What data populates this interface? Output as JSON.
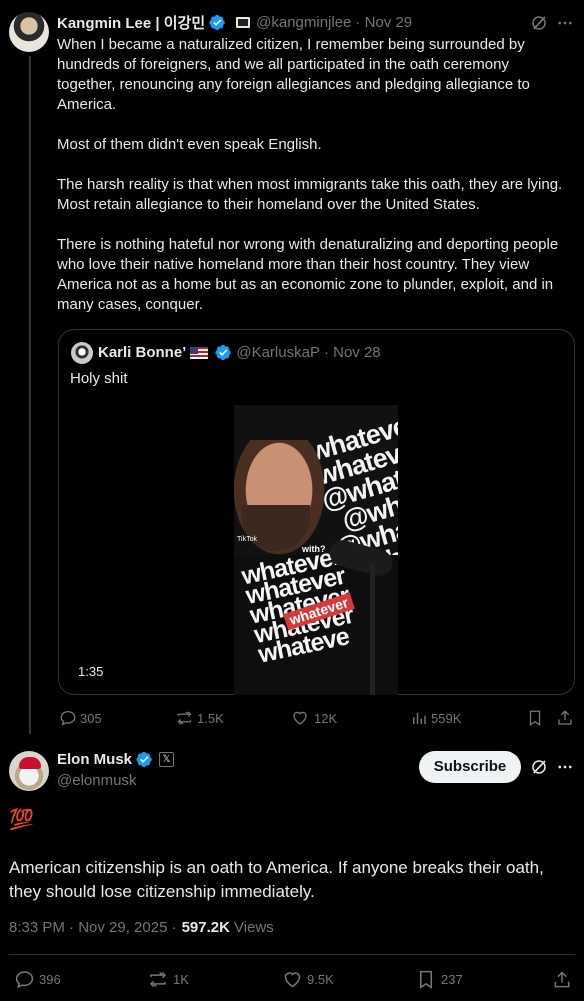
{
  "tweet1": {
    "name": "Kangmin Lee | 이강민",
    "handle": "@kangminjlee",
    "date": "· Nov 29",
    "paragraphs": [
      "When I became a naturalized citizen, I remember being surrounded by hundreds of foreigners, and we all participated in the oath ceremony together, renouncing any foreign allegiances and pledging allegiance to America.",
      "Most of them didn't even speak English.",
      "The harsh reality is that when most immigrants take this oath, they are lying. Most retain allegiance to their homeland over the United States.",
      "There is nothing hateful nor wrong with denaturalizing and deporting people who love their native homeland more than their host country. They view America not as a home but as an economic zone to plunder, exploit, and in many cases, conquer."
    ],
    "quoted": {
      "name": "Karli Bonne’",
      "handle": "@KarluskaP",
      "date": "· Nov 28",
      "text": "Holy shit",
      "video_duration": "1:35",
      "video_bg_text": "@whatever @whatever @whatev @whate @whatev @whatev",
      "video_caption": "with?",
      "video_tiktok": "TikTok",
      "video_shirt_text": "whatever whatever whatever whatever whateve",
      "video_red_text": "whatever"
    },
    "stats": {
      "replies": "305",
      "reposts": "1.5K",
      "likes": "12K",
      "views": "559K"
    }
  },
  "tweet2": {
    "name": "Elon Musk",
    "handle": "@elonmusk",
    "subscribe_label": "Subscribe",
    "emoji": "💯",
    "text": "American citizenship is an oath to America. If anyone breaks their oath, they should lose citizenship immediately.",
    "timestamp": "8:33 PM · Nov 29, 2025 ·",
    "views_count": "597.2K",
    "views_label": "Views",
    "stats": {
      "replies": "396",
      "reposts": "1K",
      "likes": "9.5K",
      "bookmarks": "237"
    }
  },
  "colors": {
    "verified": "#1d9bf0",
    "secondary_text": "#71767b",
    "primary_text": "#e7e9ea",
    "border": "#2f3336"
  }
}
